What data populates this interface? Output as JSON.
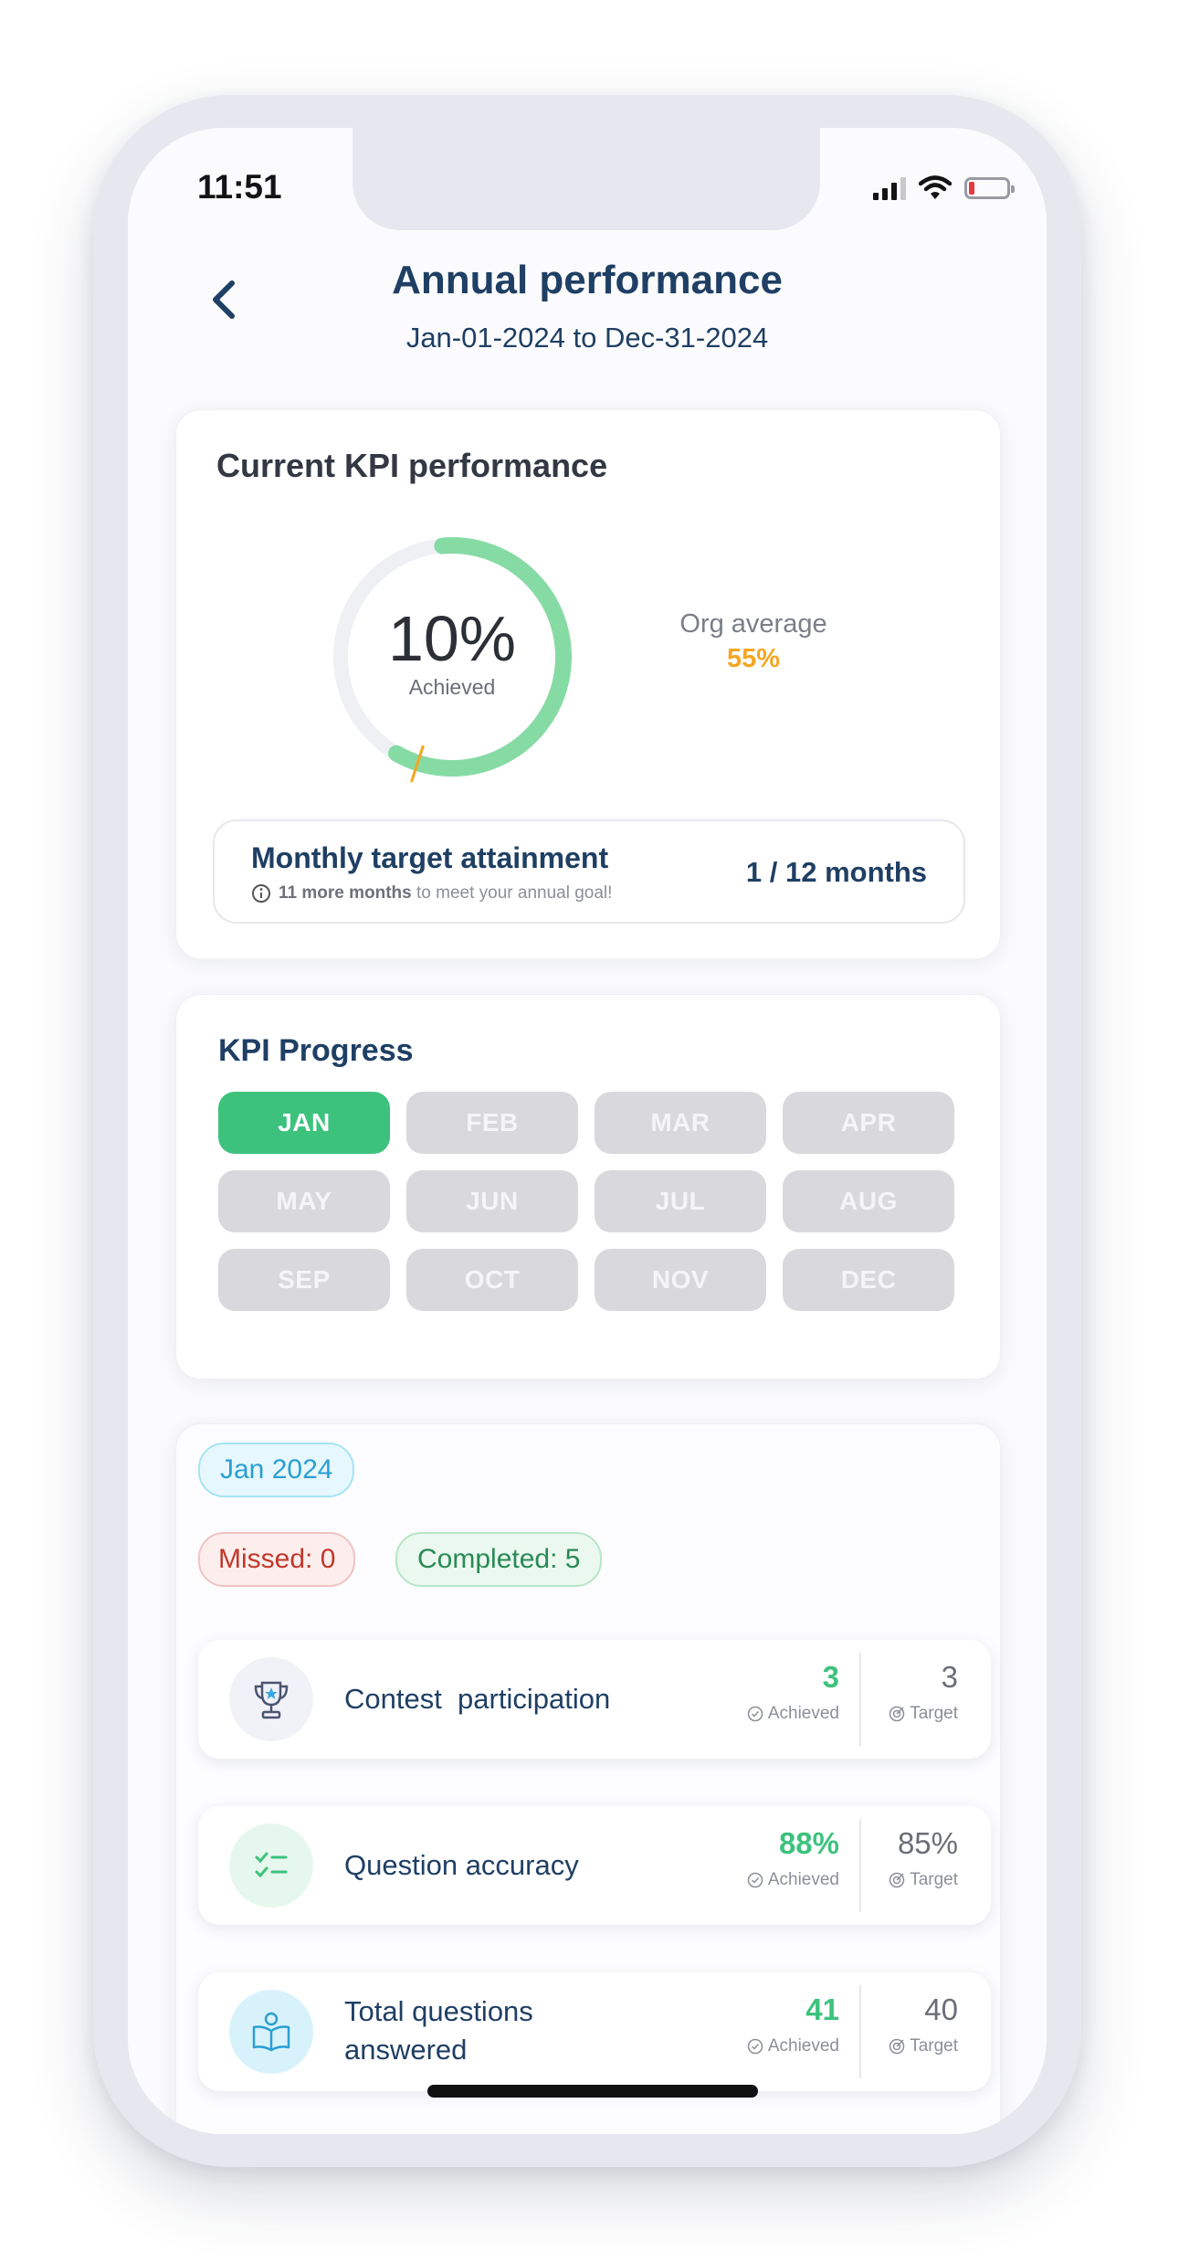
{
  "status_bar": {
    "time": "11:51"
  },
  "header": {
    "back_icon": "chevron-left-icon",
    "title": "Annual performance",
    "date_range": "Jan-01-2024 to Dec-31-2024"
  },
  "kpi_card": {
    "heading": "Current KPI performance",
    "achieved_percent": "10%",
    "achieved_label": "Achieved",
    "achieved_fraction": 0.1,
    "org_average_label": "Org average",
    "org_average_value": "55%",
    "monthly_target": {
      "title": "Monthly target attainment",
      "note_bold": "11 more months",
      "note_rest": " to meet your annual goal!",
      "value": "1 / 12 months"
    },
    "colors": {
      "ring": "#86dba4",
      "org": "#f5a623"
    }
  },
  "kpi_progress": {
    "heading": "KPI Progress",
    "months": [
      "JAN",
      "FEB",
      "MAR",
      "APR",
      "MAY",
      "JUN",
      "JUL",
      "AUG",
      "SEP",
      "OCT",
      "NOV",
      "DEC"
    ],
    "active_month": "JAN"
  },
  "month_detail": {
    "month_pill": "Jan 2024",
    "missed": "Missed: 0",
    "completed": "Completed: 5",
    "achieved_label": "Achieved",
    "target_label": "Target",
    "items": [
      {
        "label": "Contest  participation",
        "achieved": "3",
        "target": "3",
        "icon": "trophy-icon"
      },
      {
        "label": "Question accuracy",
        "achieved": "88%",
        "target": "85%",
        "icon": "checklist-icon"
      },
      {
        "label": "Total questions answered",
        "label_line1": "Total questions",
        "label_line2": "answered",
        "achieved": "41",
        "target": "40",
        "icon": "book-reader-icon"
      }
    ]
  }
}
